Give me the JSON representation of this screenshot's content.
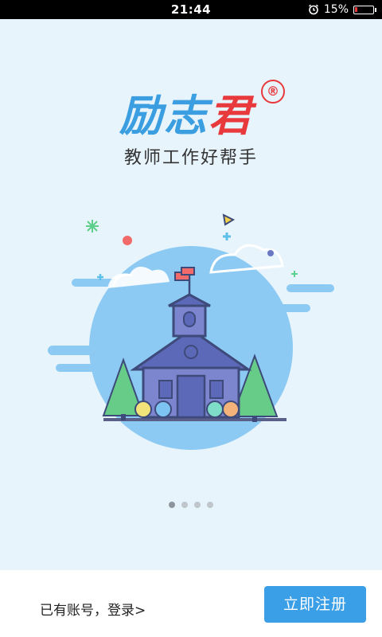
{
  "status_bar": {
    "time": "21:44",
    "battery_percent": "15%",
    "battery_level": 0.15,
    "icons": [
      "alarm-icon",
      "battery-icon"
    ]
  },
  "splash": {
    "logo": {
      "text": "励志君",
      "registered_mark": "®",
      "colors": [
        "#3b9ee0",
        "#3b9ee0",
        "#e8393d"
      ]
    },
    "tagline": "教师工作好帮手",
    "illustration": "school-building-illustration",
    "background_color": "#e8f4fc"
  },
  "pager": {
    "total": 4,
    "active_index": 0
  },
  "bottom": {
    "login_text": "已有账号，登录>",
    "register_label": "立即注册",
    "accent_color": "#3a9fe6"
  }
}
